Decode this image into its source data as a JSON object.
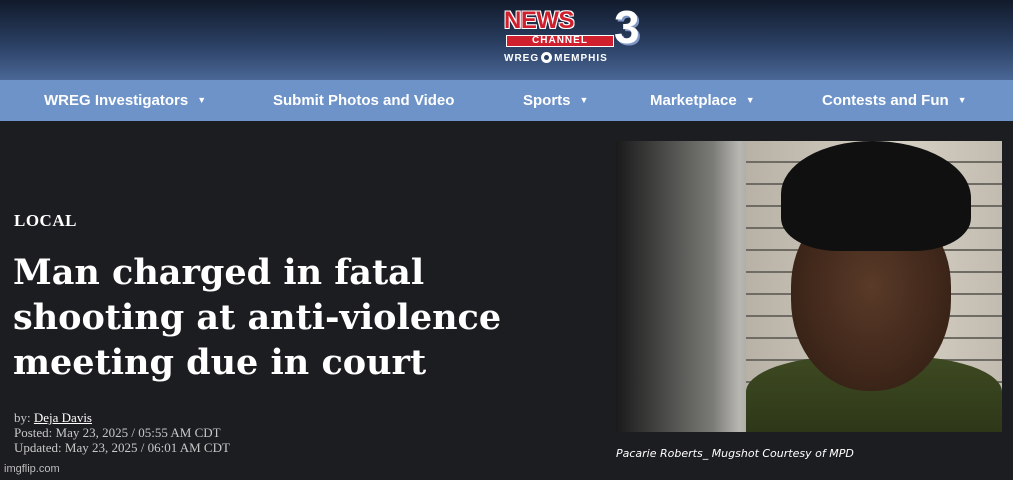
{
  "brand": {
    "logo_news": "NEWS",
    "logo_channel": "CHANNEL",
    "logo_number": "3",
    "logo_sub_left": "WREG",
    "logo_sub_right": "MEMPHIS"
  },
  "nav": {
    "items": [
      {
        "label": "WREG Investigators",
        "has_dropdown": true
      },
      {
        "label": "Submit Photos and Video",
        "has_dropdown": false
      },
      {
        "label": "Sports",
        "has_dropdown": true
      },
      {
        "label": "Marketplace",
        "has_dropdown": true
      },
      {
        "label": "Contests and Fun",
        "has_dropdown": true
      }
    ],
    "chevron": "▼"
  },
  "article": {
    "category": "LOCAL",
    "headline_lines": [
      "Man charged in fatal",
      "shooting at anti-violence",
      "meeting due in court"
    ],
    "byline_prefix": "by:",
    "author": "Deja Davis",
    "posted": "Posted: May 23, 2025 / 05:55 AM CDT",
    "updated": "Updated: May 23, 2025 / 06:01 AM CDT"
  },
  "photo": {
    "caption": "Pacarie Roberts_ Mugshot Courtesy of MPD"
  },
  "watermark": "imgflip.com",
  "colors": {
    "header_dark": "#111a2a",
    "nav_bg": "#6d93c9",
    "page_bg": "#1c1d20",
    "logo_red": "#d0202e"
  }
}
